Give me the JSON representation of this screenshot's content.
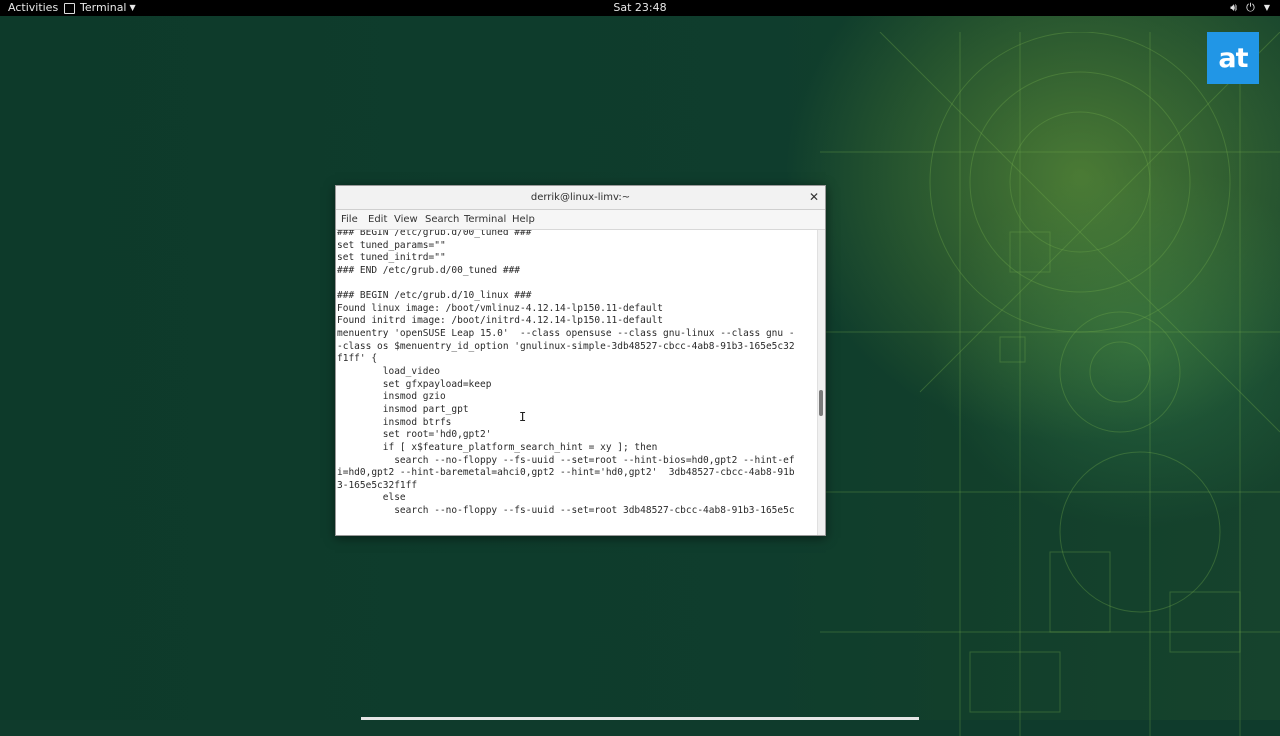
{
  "topbar": {
    "activities": "Activities",
    "app_name": "Terminal",
    "clock": "Sat 23:48"
  },
  "logo": {
    "text": "at"
  },
  "window": {
    "title": "derrik@linux-limv:~",
    "menu": [
      "File",
      "Edit",
      "View",
      "Search",
      "Terminal",
      "Help"
    ],
    "lines": [
      "### BEGIN /etc/grub.d/00_tuned ###",
      "set tuned_params=\"\"",
      "set tuned_initrd=\"\"",
      "### END /etc/grub.d/00_tuned ###",
      "",
      "### BEGIN /etc/grub.d/10_linux ###",
      "Found linux image: /boot/vmlinuz-4.12.14-lp150.11-default",
      "Found initrd image: /boot/initrd-4.12.14-lp150.11-default",
      "menuentry 'openSUSE Leap 15.0'  --class opensuse --class gnu-linux --class gnu -",
      "-class os $menuentry_id_option 'gnulinux-simple-3db48527-cbcc-4ab8-91b3-165e5c32",
      "f1ff' {",
      "        load_video",
      "        set gfxpayload=keep",
      "        insmod gzio",
      "        insmod part_gpt",
      "        insmod btrfs",
      "        set root='hd0,gpt2'",
      "        if [ x$feature_platform_search_hint = xy ]; then",
      "          search --no-floppy --fs-uuid --set=root --hint-bios=hd0,gpt2 --hint-ef",
      "i=hd0,gpt2 --hint-baremetal=ahci0,gpt2 --hint='hd0,gpt2'  3db48527-cbcc-4ab8-91b",
      "3-165e5c32f1ff",
      "        else",
      "          search --no-floppy --fs-uuid --set=root 3db48527-cbcc-4ab8-91b3-165e5c"
    ]
  }
}
